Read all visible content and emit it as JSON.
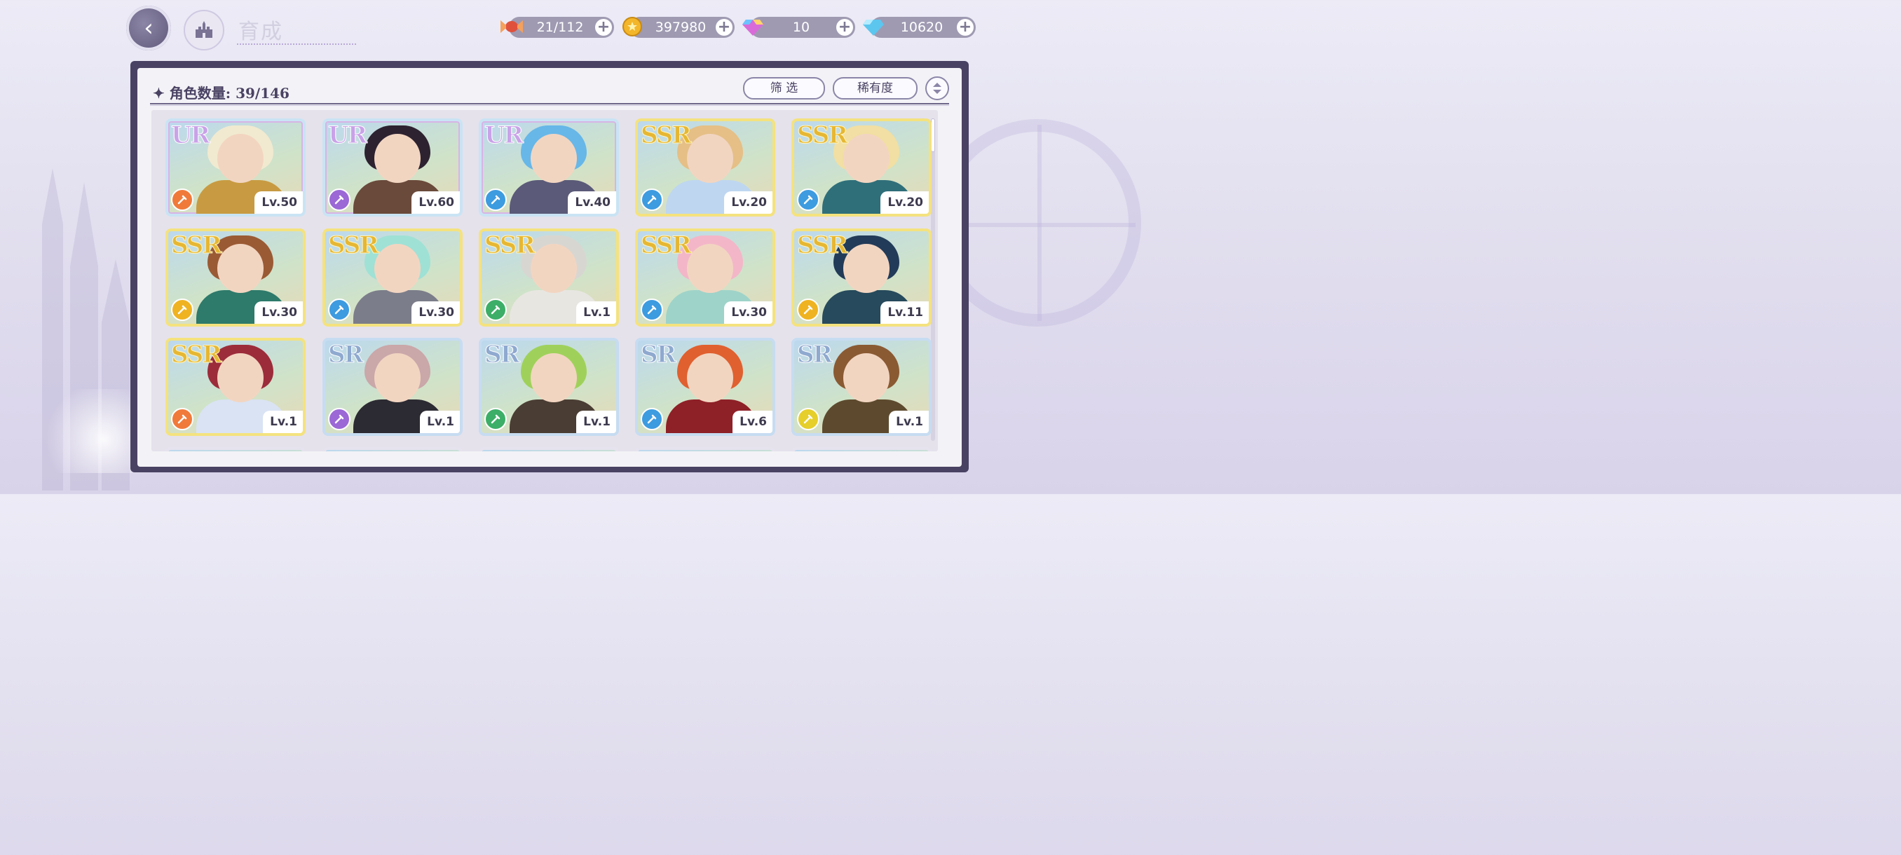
{
  "header": {
    "title": "育成",
    "currencies": [
      {
        "icon": "candy-icon",
        "value": "21/112",
        "color": "#e0513c"
      },
      {
        "icon": "gold-coin-icon",
        "value": "397980",
        "color": "#f3b52a"
      },
      {
        "icon": "rainbow-gem-icon",
        "value": "10",
        "color": "#d86bd8"
      },
      {
        "icon": "diamond-icon",
        "value": "10620",
        "color": "#5cc6ef"
      }
    ]
  },
  "panel": {
    "count_label": "角色数量: 39/146",
    "filter_label": "筛 选",
    "sort_label": "稀有度"
  },
  "colors": {
    "panel_frame": "#4a4263",
    "role_orange": "#f07a3a",
    "role_purple": "#9b68d6",
    "role_blue": "#3d9be0",
    "role_gold": "#efb321",
    "role_green": "#3cae67",
    "role_yellow": "#e6cf2a"
  },
  "cards": [
    {
      "rarity": "UR",
      "level": "Lv.50",
      "role": "role_orange",
      "hair": "#f1ead0",
      "body": "#c89b42"
    },
    {
      "rarity": "UR",
      "level": "Lv.60",
      "role": "role_purple",
      "hair": "#2d2230",
      "body": "#6a4a3b"
    },
    {
      "rarity": "UR",
      "level": "Lv.40",
      "role": "role_blue",
      "hair": "#67b7e8",
      "body": "#5b5a78"
    },
    {
      "rarity": "SSR",
      "level": "Lv.20",
      "role": "role_blue",
      "hair": "#e5bf86",
      "body": "#bed6f0"
    },
    {
      "rarity": "SSR",
      "level": "Lv.20",
      "role": "role_blue",
      "hair": "#f1dfa3",
      "body": "#2f6f7a"
    },
    {
      "rarity": "SSR",
      "level": "Lv.30",
      "role": "role_gold",
      "hair": "#9a5a34",
      "body": "#2e7a6b"
    },
    {
      "rarity": "SSR",
      "level": "Lv.30",
      "role": "role_blue",
      "hair": "#9fe1d5",
      "body": "#7c7d8a"
    },
    {
      "rarity": "SSR",
      "level": "Lv.1",
      "role": "role_green",
      "hair": "#d8d6d1",
      "body": "#e8e6e1"
    },
    {
      "rarity": "SSR",
      "level": "Lv.30",
      "role": "role_blue",
      "hair": "#f3b6c8",
      "body": "#9ed3c9"
    },
    {
      "rarity": "SSR",
      "level": "Lv.11",
      "role": "role_gold",
      "hair": "#223b58",
      "body": "#274a5c"
    },
    {
      "rarity": "SSR",
      "level": "Lv.1",
      "role": "role_orange",
      "hair": "#9c2c3a",
      "body": "#d9e3f3"
    },
    {
      "rarity": "SR",
      "level": "Lv.1",
      "role": "role_purple",
      "hair": "#caa7a9",
      "body": "#2c2a32"
    },
    {
      "rarity": "SR",
      "level": "Lv.1",
      "role": "role_green",
      "hair": "#9fd15a",
      "body": "#4a3d33"
    },
    {
      "rarity": "SR",
      "level": "Lv.6",
      "role": "role_blue",
      "hair": "#e0602f",
      "body": "#8e2027"
    },
    {
      "rarity": "SR",
      "level": "Lv.1",
      "role": "role_yellow",
      "hair": "#8a5a33",
      "body": "#5d4a2e"
    }
  ]
}
